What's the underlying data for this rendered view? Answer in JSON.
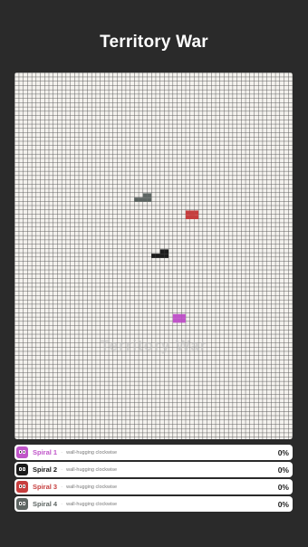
{
  "header": {
    "title": "Territory War"
  },
  "board": {
    "cols": 65,
    "rows": 85,
    "watermark": "Territory War",
    "cells": [
      {
        "player": 3,
        "col": 28,
        "row": 29
      },
      {
        "player": 3,
        "col": 29,
        "row": 29
      },
      {
        "player": 3,
        "col": 30,
        "row": 29
      },
      {
        "player": 3,
        "col": 31,
        "row": 29
      },
      {
        "player": 3,
        "col": 30,
        "row": 28
      },
      {
        "player": 3,
        "col": 31,
        "row": 28
      },
      {
        "player": 2,
        "col": 40,
        "row": 33
      },
      {
        "player": 2,
        "col": 41,
        "row": 33
      },
      {
        "player": 2,
        "col": 40,
        "row": 32
      },
      {
        "player": 2,
        "col": 41,
        "row": 32
      },
      {
        "player": 2,
        "col": 42,
        "row": 32
      },
      {
        "player": 2,
        "col": 41,
        "row": 33
      },
      {
        "player": 2,
        "col": 42,
        "row": 33
      },
      {
        "player": 1,
        "col": 32,
        "row": 42
      },
      {
        "player": 1,
        "col": 33,
        "row": 42
      },
      {
        "player": 1,
        "col": 34,
        "row": 41
      },
      {
        "player": 1,
        "col": 35,
        "row": 41
      },
      {
        "player": 1,
        "col": 34,
        "row": 42
      },
      {
        "player": 1,
        "col": 35,
        "row": 42
      },
      {
        "player": 0,
        "col": 37,
        "row": 57
      },
      {
        "player": 0,
        "col": 38,
        "row": 57
      },
      {
        "player": 0,
        "col": 37,
        "row": 56
      },
      {
        "player": 0,
        "col": 38,
        "row": 56
      },
      {
        "player": 0,
        "col": 39,
        "row": 56
      },
      {
        "player": 0,
        "col": 39,
        "row": 57
      }
    ]
  },
  "players": [
    {
      "name": "Spiral 1",
      "strategy": "wall-hugging clockwise",
      "percent": "0%",
      "color": "#c055c9",
      "name_color": "#c055c9"
    },
    {
      "name": "Spiral 2",
      "strategy": "wall-hugging clockwise",
      "percent": "0%",
      "color": "#1b1b1b",
      "name_color": "#1b1b1b"
    },
    {
      "name": "Spiral 3",
      "strategy": "wall-hugging clockwise",
      "percent": "0%",
      "color": "#c63e3e",
      "name_color": "#c63e3e"
    },
    {
      "name": "Spiral 4",
      "strategy": "wall-hugging clockwise",
      "percent": "0%",
      "color": "#5e6663",
      "name_color": "#5e6663"
    }
  ],
  "separator": "·"
}
